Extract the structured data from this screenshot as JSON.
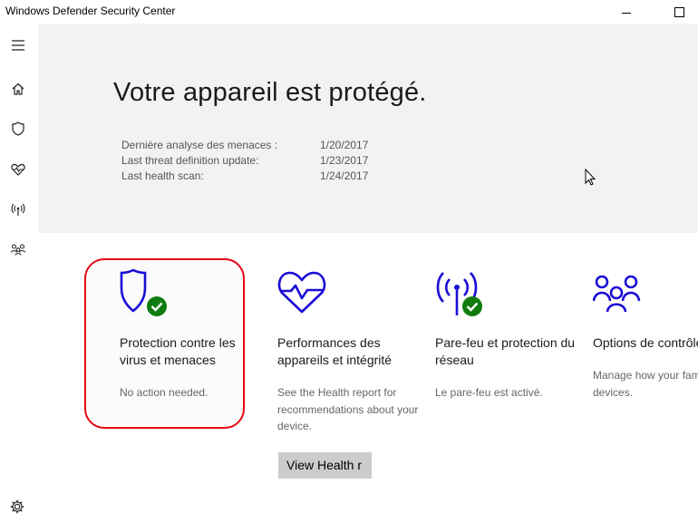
{
  "window": {
    "title": "Windows Defender Security Center"
  },
  "sidebar": {
    "items": [
      {
        "icon": "hamburger-menu-icon"
      },
      {
        "icon": "home-icon"
      },
      {
        "icon": "shield-icon"
      },
      {
        "icon": "heart-pulse-icon"
      },
      {
        "icon": "antenna-icon"
      },
      {
        "icon": "family-icon"
      }
    ],
    "settings_icon": "gear-icon"
  },
  "hero": {
    "heading": "Votre appareil est protégé.",
    "scans": [
      {
        "label": "Dernière analyse des menaces :",
        "value": "1/20/2017"
      },
      {
        "label": "Last threat definition update:",
        "value": "1/23/2017"
      },
      {
        "label": "Last health scan:",
        "value": "1/24/2017"
      }
    ]
  },
  "cards": [
    {
      "icon": "shield-check-icon",
      "title": "Protection contre les virus et menaces",
      "description": "No action needed."
    },
    {
      "icon": "heart-pulse-icon",
      "title": "Performances des appareils et intégrité",
      "description": "See the Health report for recommendations about your device."
    },
    {
      "icon": "antenna-check-icon",
      "title": "Pare-feu et protection du réseau",
      "description": "Le pare-feu est activé."
    },
    {
      "icon": "family-icon",
      "title": "Options de contrôle parental",
      "description": "Manage how your family uses their devices."
    }
  ],
  "actions": {
    "view_health_label": "View Health r"
  },
  "colors": {
    "accent": "#1a0dd6",
    "ok": "#107c10",
    "highlight": "#e30613",
    "hero_bg": "#f2f2f2"
  }
}
